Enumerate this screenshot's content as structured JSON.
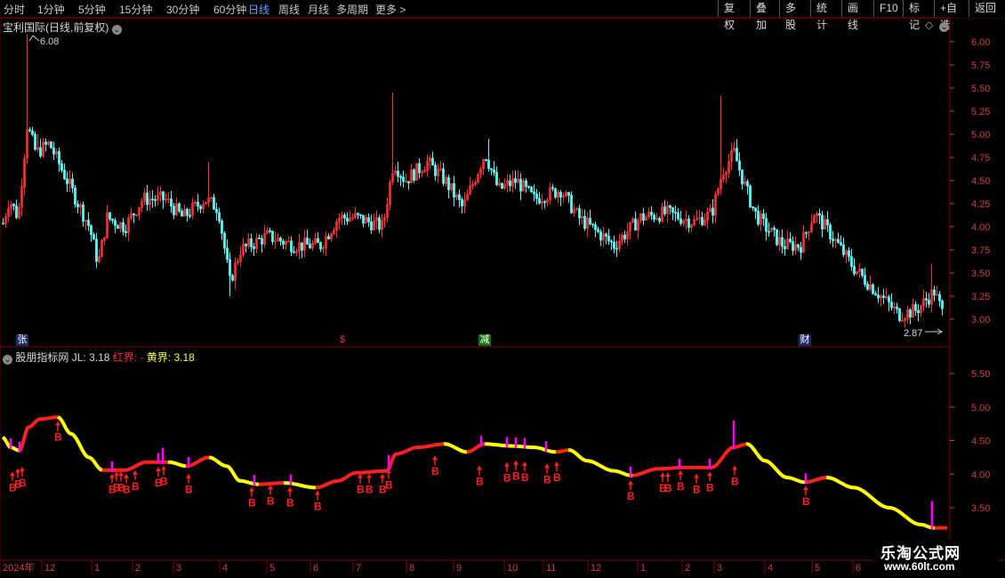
{
  "toolbar": {
    "periods": [
      "分时",
      "1分钟",
      "5分钟",
      "15分钟",
      "30分钟",
      "60分钟",
      "日线",
      "周线",
      "月线",
      "多周期",
      "更多"
    ],
    "active": "日线",
    "buttons": [
      "复权",
      "叠加",
      "多股",
      "统计",
      "画线",
      "F10",
      "标记",
      "+自选",
      "返回"
    ]
  },
  "main_panel": {
    "title": "宝利国际(日线,前复权)",
    "high_marker": "6.08",
    "low_marker": "2.87",
    "y_ticks": [
      "6.00",
      "5.75",
      "5.50",
      "5.25",
      "5.00",
      "4.75",
      "4.50",
      "4.25",
      "4.00",
      "3.75",
      "3.50",
      "3.25",
      "3.00"
    ],
    "events": [
      {
        "label": "张",
        "color": "#ffffff",
        "bg": "#1a2a6a"
      },
      {
        "label": "$",
        "color": "#ff3030",
        "bg": "#000000"
      },
      {
        "label": "减",
        "color": "#ffffff",
        "bg": "#107010"
      },
      {
        "label": "财",
        "color": "#ffffff",
        "bg": "#1a2a6a"
      }
    ]
  },
  "indicator_panel": {
    "name": "股朋指标网",
    "jl_label": "JL:",
    "jl_value": "3.18",
    "red_label": "红界:",
    "red_value": "-",
    "yellow_label": "黄界:",
    "yellow_value": "3.18",
    "y_ticks": [
      "5.50",
      "5.00",
      "4.50",
      "4.00",
      "3.50"
    ],
    "signal_label": "B"
  },
  "x_axis": {
    "labels": [
      "2024年",
      "12",
      "1",
      "2",
      "3",
      "4",
      "5",
      "6",
      "7",
      "8",
      "9",
      "10",
      "11",
      "12",
      "1",
      "2",
      "3",
      "4",
      "5",
      "6"
    ]
  },
  "watermark": {
    "line1": "乐淘公式网",
    "line2": "www.60lt.com"
  },
  "colors": {
    "up": "#ff3030",
    "down": "#54fcfc",
    "grid": "#800000",
    "yellow": "#ffff00",
    "magenta": "#ff00ff"
  },
  "chart_data": {
    "type": "candlestick",
    "price_range": [
      2.87,
      6.08
    ],
    "indicator": {
      "name": "JL",
      "last": 3.18,
      "y_range": [
        3.2,
        5.7
      ],
      "segments_color_by_trend": [
        "red",
        "yellow"
      ]
    }
  }
}
